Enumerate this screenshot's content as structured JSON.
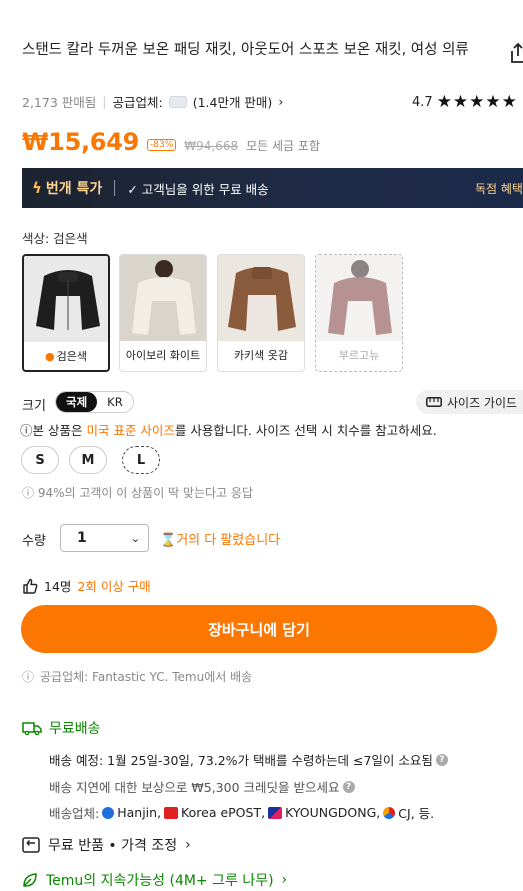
{
  "product": {
    "title": "스탠드 칼라 두꺼운 보온 패딩 재킷, 아웃도어 스포츠 보온 재킷, 여성 의류",
    "sold": "2,173 판매됨",
    "supplier_label": "공급업체:",
    "supplier_sales": "(1.4만개 판매)",
    "rating": "4.7",
    "stars": "★★★★★"
  },
  "price": {
    "current": "₩15,649",
    "discount": "-83%",
    "original": "₩94,668",
    "tax_note": "모든 세금 포함"
  },
  "banner": {
    "flash": "번개 특가",
    "shipping": "고객님을 위한 무료 배송",
    "exclusive": "독점 혜택"
  },
  "colors": {
    "label": "색상: 검은색",
    "options": [
      {
        "name": "검은색",
        "selected": true,
        "color": "#1e1e1e"
      },
      {
        "name": "아이보리 화이트",
        "selected": false,
        "color": "#efeae0"
      },
      {
        "name": "카키색 옷감",
        "selected": false,
        "color": "#8a5a3c"
      },
      {
        "name": "부르고뉴",
        "selected": false,
        "color": "#7a3a3a"
      }
    ]
  },
  "size": {
    "label": "크기",
    "toggle": [
      "국제",
      "KR"
    ],
    "guide": "사이즈 가이드",
    "notice_pre": "본 상품은 ",
    "notice_hl": "미국 표준 사이즈",
    "notice_post": "를 사용합니다. 사이즈 선택 시 치수를 참고하세요.",
    "options": [
      "S",
      "M",
      "L"
    ],
    "fit": "94%의 고객이 이 상품이 딱 맞는다고 응답"
  },
  "quantity": {
    "label": "수량",
    "value": "1",
    "almost_gone": "거의 다 팔렸습니다"
  },
  "repeat": {
    "count": "14명",
    "hl": "2회 이상 구매"
  },
  "cart_button": "장바구니에 담기",
  "shipper": "공급업체: Fantastic YC. Temu에서 배송",
  "shipping": {
    "free": "무료배송",
    "eta": "배송 예정: 1월 25일-30일, 73.2%가 택배를 수령하는데 ≤7일이 소요됨",
    "delay": "배송 지연에 대한 보상으로 ₩5,300 크레딧을 받으세요",
    "carriers_label": "배송업체:",
    "carriers": [
      "Hanjin,",
      "Korea ePOST,",
      "KYOUNGDONG,",
      "CJ, 등."
    ]
  },
  "returns": "무료 반품 • 가격 조정",
  "sustainability": "Temu의 지속가능성 (4M+ 그루 나무)",
  "accent": "#fb7701",
  "green": "#0a8800"
}
